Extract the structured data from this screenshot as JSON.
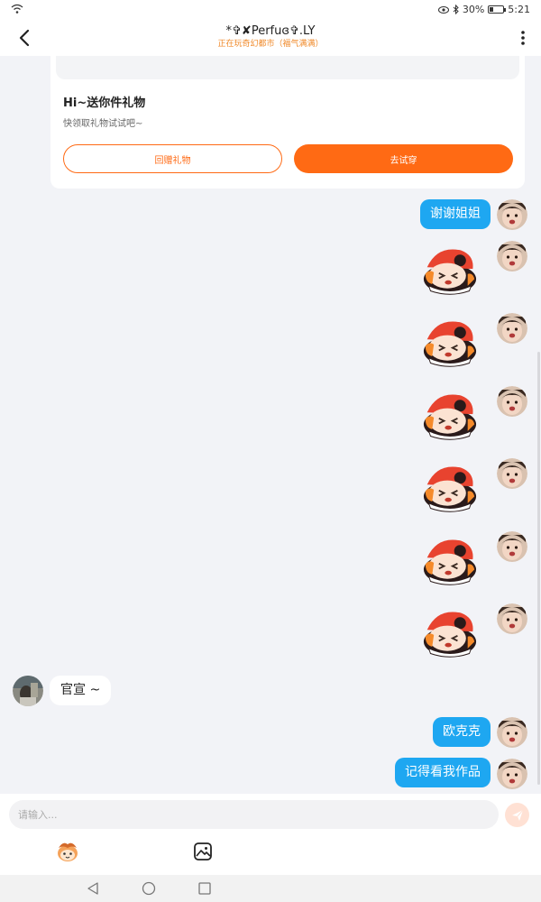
{
  "status_bar": {
    "battery_percent": "30%",
    "battery_level": 0.3,
    "time": "5:21"
  },
  "header": {
    "title": "*✞✘Perfuɞ✞.LY",
    "subtitle": "正在玩奇幻都市（福气满满）"
  },
  "gift_card": {
    "title": "Hi~送你件礼物",
    "desc": "快领取礼物试试吧~",
    "return_gift_label": "回赠礼物",
    "try_on_label": "去试穿"
  },
  "messages": [
    {
      "sender": "me",
      "type": "text",
      "text": "谢谢姐姐"
    },
    {
      "sender": "me",
      "type": "sticker",
      "sticker": "anime-girl-sticker"
    },
    {
      "sender": "me",
      "type": "sticker",
      "sticker": "anime-girl-sticker"
    },
    {
      "sender": "me",
      "type": "sticker",
      "sticker": "anime-girl-sticker"
    },
    {
      "sender": "me",
      "type": "sticker",
      "sticker": "anime-girl-sticker"
    },
    {
      "sender": "me",
      "type": "sticker",
      "sticker": "anime-girl-sticker"
    },
    {
      "sender": "me",
      "type": "sticker",
      "sticker": "anime-girl-sticker"
    },
    {
      "sender": "other",
      "type": "text",
      "text": "官宣 ~"
    },
    {
      "sender": "me",
      "type": "text",
      "text": "欧克克"
    },
    {
      "sender": "me",
      "type": "text",
      "text": "记得看我作品"
    }
  ],
  "input": {
    "placeholder": "请输入..."
  },
  "icons": {
    "back": "back-arrow-icon",
    "more": "more-vertical-icon",
    "send": "send-icon",
    "emoji": "emoji-icon",
    "image": "image-icon",
    "nav_back": "nav-back-icon",
    "nav_home": "nav-home-icon",
    "nav_recent": "nav-recent-icon"
  },
  "colors": {
    "accent": "#ff6a14",
    "bubble_me": "#1ea7f1",
    "background": "#f2f3f7"
  }
}
